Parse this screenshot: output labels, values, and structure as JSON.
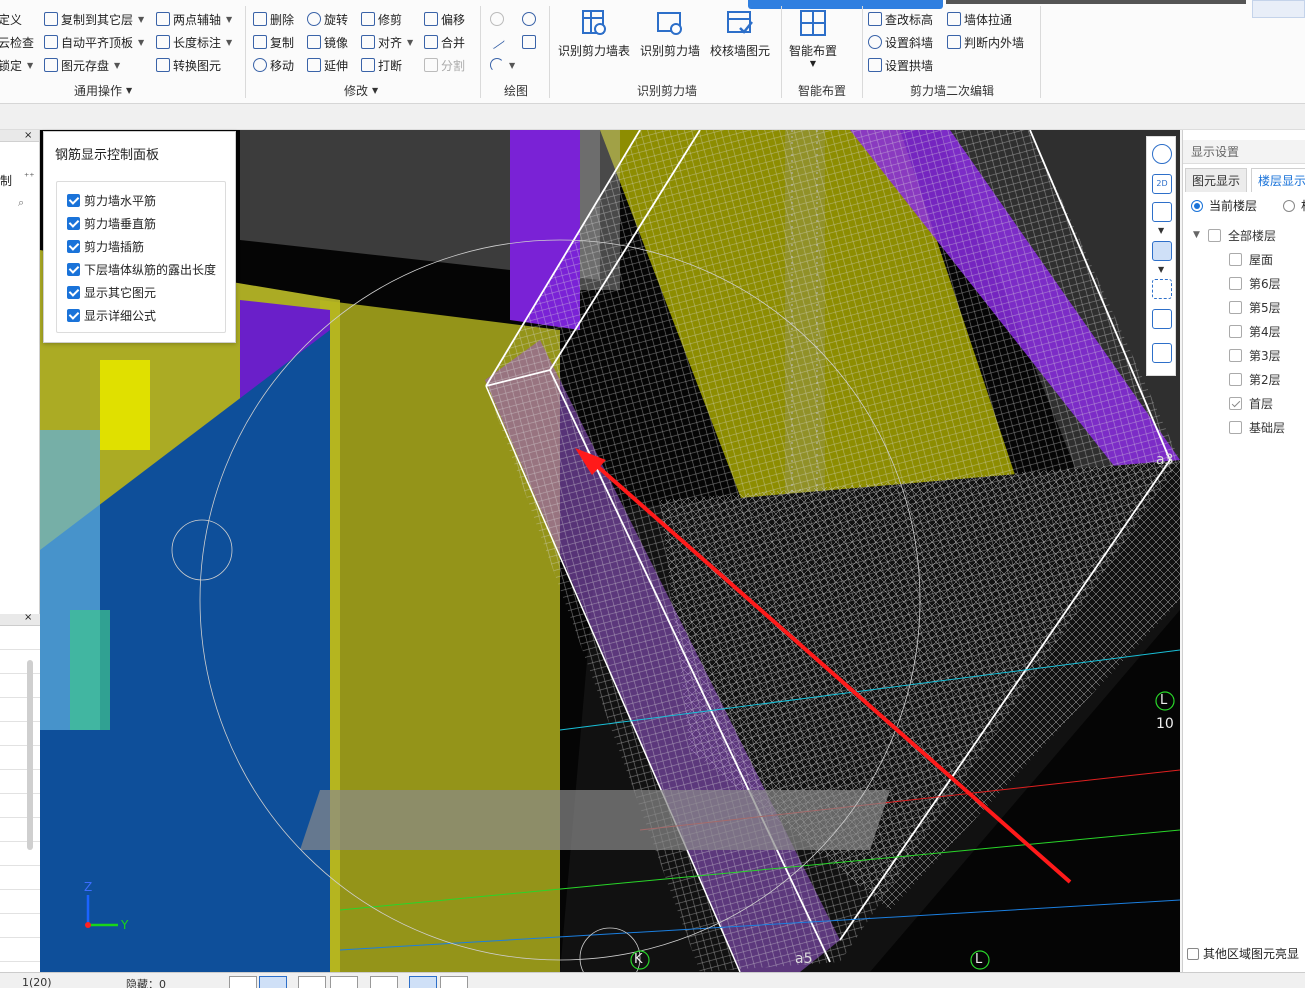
{
  "ribbon": {
    "col1": [
      "定义",
      "云检查",
      "锁定"
    ],
    "col2": [
      "复制到其它层",
      "自动平齐顶板",
      "图元存盘"
    ],
    "col3": [
      "两点辅轴",
      "长度标注",
      "转换图元"
    ],
    "group_general": "通用操作",
    "modify": {
      "row1": [
        "删除",
        "旋转",
        "修剪",
        "偏移"
      ],
      "row2": [
        "复制",
        "镜像",
        "对齐",
        "合并"
      ],
      "row3": [
        "移动",
        "延伸",
        "打断",
        "分割"
      ]
    },
    "group_modify": "修改",
    "group_draw": "绘图",
    "big_buttons": [
      "识别剪力墙表",
      "识别剪力墙",
      "校核墙图元"
    ],
    "group_recognize": "识别剪力墙",
    "smart_layout": "智能布置",
    "group_smart": "智能布置",
    "edit_items": [
      "查改标高",
      "设置斜墙",
      "设置拱墙",
      "墙体拉通",
      "判断内外墙"
    ],
    "group_edit": "剪力墙二次编辑"
  },
  "left": {
    "text1": "制",
    "text2": "⁺⁺",
    "close1": "×",
    "close2": "×",
    "search_icon": "search-icon"
  },
  "rebar_panel": {
    "title": "钢筋显示控制面板",
    "options": [
      {
        "label": "剪力墙水平筋",
        "checked": true
      },
      {
        "label": "剪力墙垂直筋",
        "checked": true
      },
      {
        "label": "剪力墙插筋",
        "checked": true
      },
      {
        "label": "下层墙体纵筋的露出长度",
        "checked": true
      },
      {
        "label": "显示其它图元",
        "checked": true
      },
      {
        "label": "显示详细公式",
        "checked": true
      }
    ]
  },
  "viewport_labels": {
    "a3": "a3",
    "a5": "a5",
    "L": "L",
    "ten": "10",
    "K": "K",
    "L2": "L",
    "axis_z": "Z",
    "axis_y": "Y"
  },
  "right_panel": {
    "header": "显示设置",
    "tab1": "图元显示",
    "tab2": "楼层显示",
    "radio1": "当前楼层",
    "radio2": "相",
    "all_floors": "全部楼层",
    "floors": [
      {
        "label": "屋面",
        "checked": false
      },
      {
        "label": "第6层",
        "checked": false
      },
      {
        "label": "第5层",
        "checked": false
      },
      {
        "label": "第4层",
        "checked": false
      },
      {
        "label": "第3层",
        "checked": false
      },
      {
        "label": "第2层",
        "checked": false
      },
      {
        "label": "首层",
        "checked": true
      },
      {
        "label": "基础层",
        "checked": false
      }
    ],
    "bottom_check": "其他区域图元亮显"
  },
  "statusbar": {
    "page": "1(20)",
    "offset": "隐藏：0"
  },
  "colors": {
    "accent": "#1a73d9",
    "wall_purple": "#8a2be2",
    "wall_yellow": "#e6e600",
    "wall_blue": "#0e4f9a",
    "arrow_red": "#ff1a1a"
  }
}
